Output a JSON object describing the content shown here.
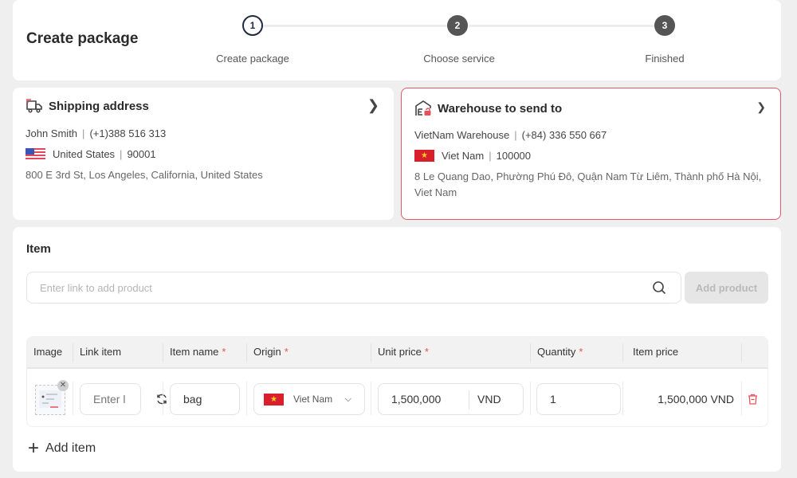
{
  "header": {
    "title": "Create package",
    "steps": [
      {
        "number": "1",
        "label": "Create package",
        "state": "active"
      },
      {
        "number": "2",
        "label": "Choose service",
        "state": "inactive"
      },
      {
        "number": "3",
        "label": "Finished",
        "state": "inactive"
      }
    ]
  },
  "shipping": {
    "title": "Shipping address",
    "icon": "truck-icon",
    "name": "John Smith",
    "phone": "(+1)388 516 313",
    "country": "United States",
    "postal": "90001",
    "address": "800 E 3rd St, Los Angeles, California, United States"
  },
  "warehouse": {
    "title": "Warehouse to send to",
    "icon": "warehouse-icon",
    "name": "VietNam Warehouse",
    "phone": "(+84) 336 550 667",
    "country": "Viet Nam",
    "postal": "100000",
    "address": "8 Le Quang Dao, Phường Phú Đô, Quận Nam Từ Liêm, Thành phố Hà Nội, Viet Nam",
    "border_color": "#e05a67"
  },
  "items": {
    "title": "Item",
    "link_placeholder": "Enter link to add product",
    "add_product_label": "Add product",
    "columns": [
      {
        "label": "Image",
        "required": false
      },
      {
        "label": "Link item",
        "required": false
      },
      {
        "label": "Item name",
        "required": true
      },
      {
        "label": "Origin",
        "required": true
      },
      {
        "label": "Unit price",
        "required": true
      },
      {
        "label": "Quantity",
        "required": true
      },
      {
        "label": "Item price",
        "required": false
      }
    ],
    "required_mark": "*",
    "rows": [
      {
        "link_placeholder": "Enter l",
        "name": "bag",
        "origin": "Viet Nam",
        "unit_price": "1,500,000",
        "currency": "VND",
        "quantity": "1",
        "item_price": "1,500,000 VND"
      }
    ],
    "add_item_label": "Add item"
  },
  "colors": {
    "accent_red": "#e8505b",
    "step_active": "#1f2a44",
    "step_inactive": "#555555"
  }
}
